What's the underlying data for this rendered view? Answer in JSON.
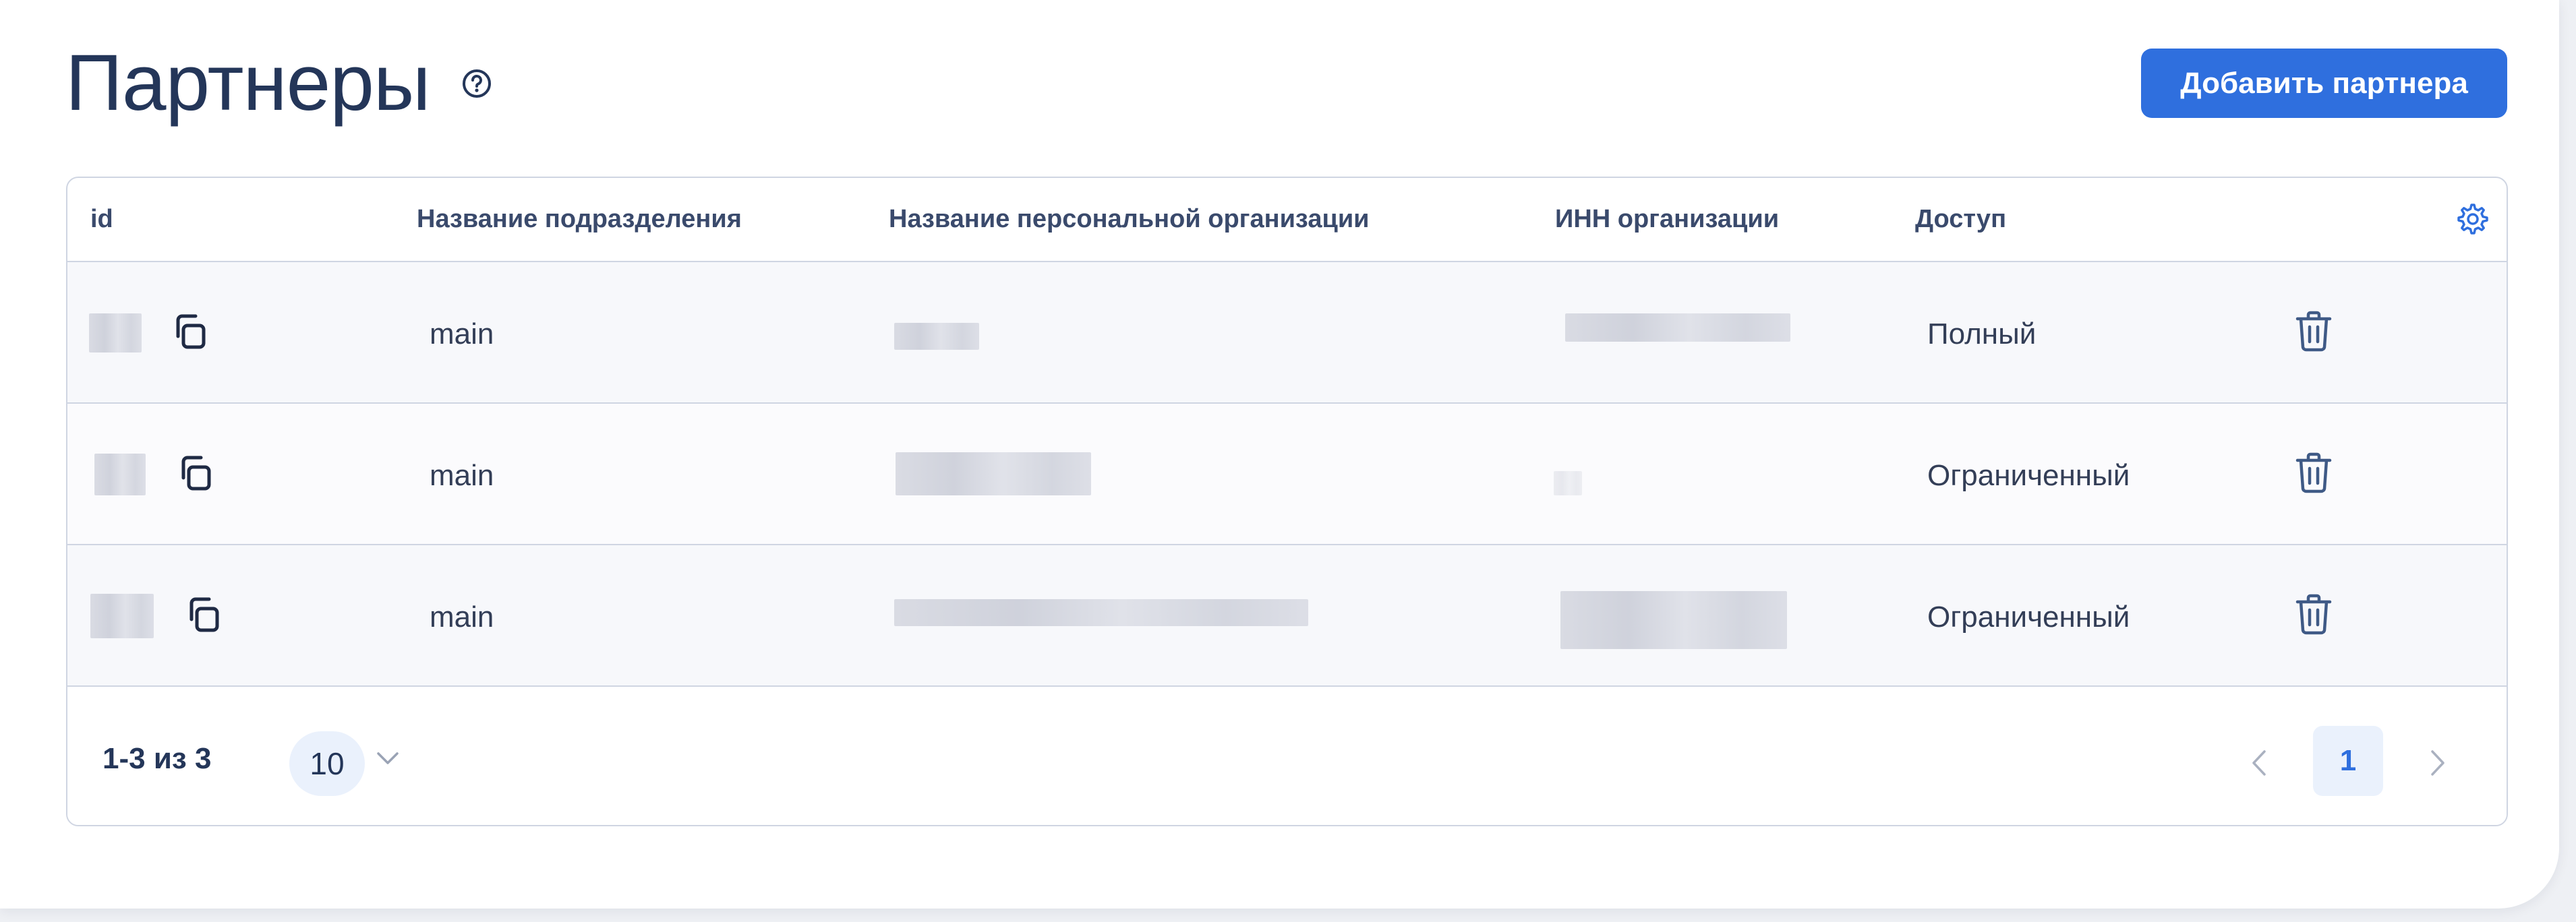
{
  "page": {
    "title": "Партнеры",
    "add_button_label": "Добавить партнера"
  },
  "table": {
    "columns": [
      "id",
      "Название подразделения",
      "Название персональной организации",
      "ИНН организации",
      "Доступ"
    ],
    "rows": [
      {
        "division": "main",
        "access": "Полный"
      },
      {
        "division": "main",
        "access": "Ограниченный"
      },
      {
        "division": "main",
        "access": "Ограниченный"
      }
    ]
  },
  "pagination": {
    "range_label": "1-3 из 3",
    "page_size": "10",
    "current_page": "1"
  },
  "colors": {
    "accent": "#2f6fde",
    "border": "#cfd5e2",
    "title": "#243659"
  },
  "icons": [
    "help-icon",
    "settings-gear-icon",
    "copy-icon",
    "trash-icon",
    "chevron-down-icon",
    "chevron-left-icon",
    "chevron-right-icon"
  ]
}
